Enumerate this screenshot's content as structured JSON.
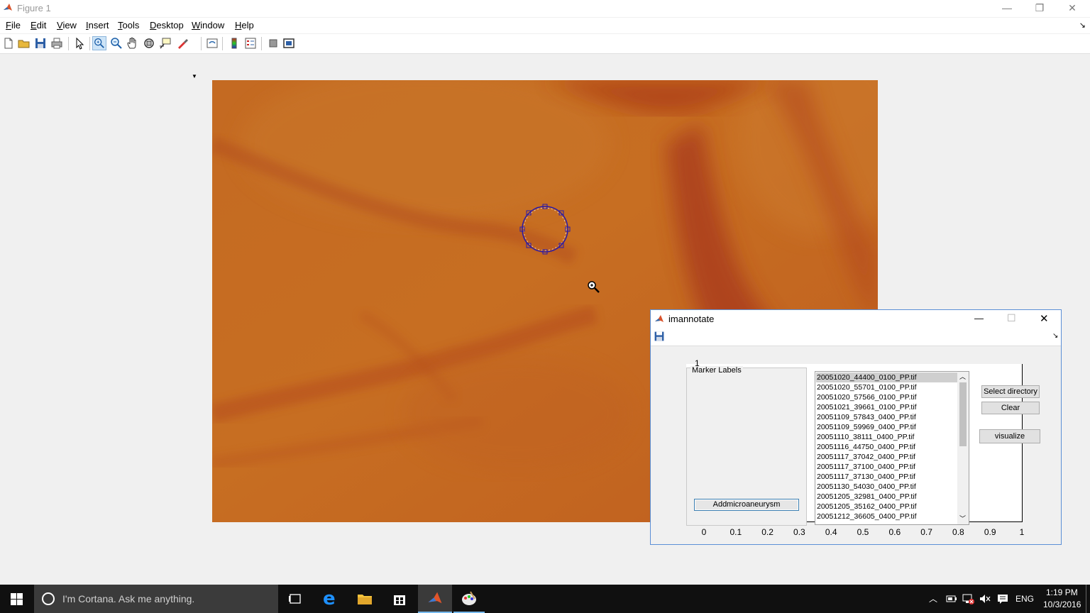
{
  "window": {
    "title": "Figure 1",
    "minimize_glyph": "—",
    "maximize_glyph": "❐",
    "close_glyph": "✕",
    "icon": "matlab-icon"
  },
  "menu": {
    "items": [
      "File",
      "Edit",
      "View",
      "Insert",
      "Tools",
      "Desktop",
      "Window",
      "Help"
    ],
    "underline": [
      "F",
      "E",
      "V",
      "I",
      "T",
      "D",
      "W",
      "H"
    ],
    "dock_glyph": "↘"
  },
  "toolbar": {
    "buttons": [
      "new-figure-icon",
      "open-file-icon",
      "save-icon",
      "print-icon",
      "edit-plot-arrow-icon",
      "zoom-in-icon",
      "zoom-out-icon",
      "pan-hand-icon",
      "rotate-3d-icon",
      "data-cursor-icon",
      "brush-icon",
      "link-plot-icon",
      "insert-colorbar-icon",
      "insert-legend-icon",
      "hide-plot-tools-icon",
      "show-plot-tools-icon"
    ],
    "active": "zoom-in-icon"
  },
  "dialog": {
    "title": "imannotate",
    "minimize_glyph": "—",
    "maximize_glyph": "☐",
    "close_glyph": "✕",
    "dock_glyph": "↘",
    "panel_label": "Marker Labels",
    "axis_top_label": "1",
    "add_button": "Addmicroaneurysm",
    "select_directory_button": "Select directory",
    "clear_button": "Clear",
    "visualize_button": "visualize",
    "x_ticks": [
      "0",
      "0.1",
      "0.2",
      "0.3",
      "0.4",
      "0.5",
      "0.6",
      "0.7",
      "0.8",
      "0.9",
      "1"
    ],
    "files": [
      "20051020_44400_0100_PP.tif",
      "20051020_55701_0100_PP.tif",
      "20051020_57566_0100_PP.tif",
      "20051021_39661_0100_PP.tif",
      "20051109_57843_0400_PP.tif",
      "20051109_59969_0400_PP.tif",
      "20051110_38111_0400_PP.tif",
      "20051116_44750_0400_PP.tif",
      "20051117_37042_0400_PP.tif",
      "20051117_37100_0400_PP.tif",
      "20051117_37130_0400_PP.tif",
      "20051130_54030_0400_PP.tif",
      "20051205_32981_0400_PP.tif",
      "20051205_35162_0400_PP.tif",
      "20051212_36605_0400_PP.tif"
    ],
    "selected_file_index": 0
  },
  "taskbar": {
    "search_placeholder": "I'm Cortana. Ask me anything.",
    "language": "ENG",
    "time": "1:19 PM",
    "date": "10/3/2016"
  },
  "colors": {
    "accent": "#3c7fb1",
    "image_base": "#c86e22",
    "marker_circle": "#2a1aa8"
  }
}
